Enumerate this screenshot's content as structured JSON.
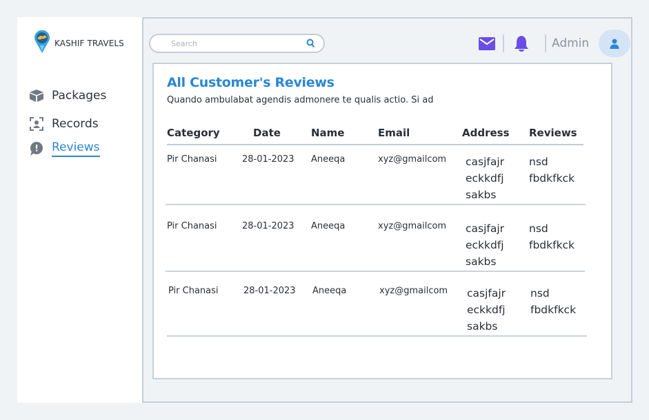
{
  "brand": {
    "name": "KASHIF TRAVELS"
  },
  "sidebar": {
    "items": [
      {
        "label": "Packages",
        "icon": "box-icon"
      },
      {
        "label": "Records",
        "icon": "scan-user-icon"
      },
      {
        "label": "Reviews",
        "icon": "alert-chat-icon",
        "active": true
      }
    ]
  },
  "search": {
    "placeholder": "Search",
    "value": ""
  },
  "header": {
    "user_label": "Admin"
  },
  "reviews": {
    "title": "All Customer's Reviews",
    "subtitle": "Quando ambulabat agendis admonere te qualis actio. Si ad",
    "columns": [
      "Category",
      "Date",
      "Name",
      "Email",
      "Address",
      "Reviews"
    ],
    "rows": [
      {
        "category": "Pir Chanasi",
        "date": "28-01-2023",
        "name": "Aneeqa",
        "email": "xyz@gmailcom",
        "address": "casjfajr eckkdfj sakbs",
        "review": "nsd fbdkfkck"
      },
      {
        "category": "Pir Chanasi",
        "date": "28-01-2023",
        "name": "Aneeqa",
        "email": "xyz@gmailcom",
        "address": "casjfajr eckkdfj sakbs",
        "review": "nsd fbdkfkck"
      },
      {
        "category": "Pir Chanasi",
        "date": "28-01-2023",
        "name": "Aneeqa",
        "email": "xyz@gmailcom",
        "address": "casjfajr eckkdfj sakbs",
        "review": "nsd fbdkfkck"
      }
    ]
  },
  "colors": {
    "accent": "#2b87d3",
    "icon_purple": "#6b4de6",
    "border": "#c4ced8",
    "background": "#f0f3f6"
  }
}
